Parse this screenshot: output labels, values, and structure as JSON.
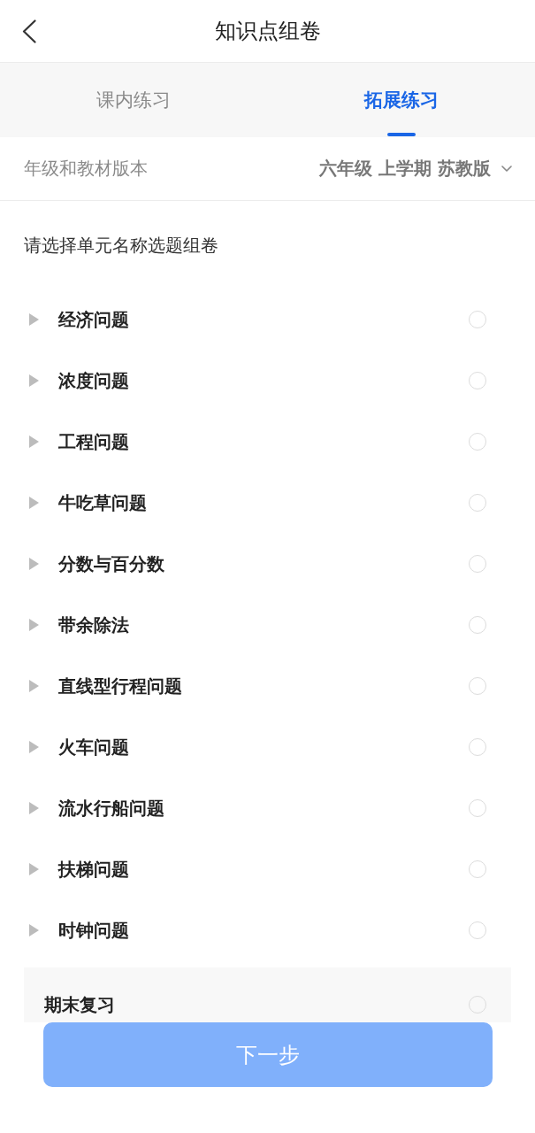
{
  "header": {
    "title": "知识点组卷"
  },
  "tabs": [
    {
      "label": "课内练习",
      "selected": false
    },
    {
      "label": "拓展练习",
      "selected": true
    }
  ],
  "grade_selector": {
    "label": "年级和教材版本",
    "value": "六年级 上学期 苏教版"
  },
  "instruction": "请选择单元名称选题组卷",
  "units": [
    {
      "name": "经济问题",
      "expanded": false,
      "selected": false
    },
    {
      "name": "浓度问题",
      "expanded": false,
      "selected": false
    },
    {
      "name": "工程问题",
      "expanded": false,
      "selected": false
    },
    {
      "name": "牛吃草问题",
      "expanded": false,
      "selected": false
    },
    {
      "name": "分数与百分数",
      "expanded": false,
      "selected": false
    },
    {
      "name": "带余除法",
      "expanded": false,
      "selected": false
    },
    {
      "name": "直线型行程问题",
      "expanded": false,
      "selected": false
    },
    {
      "name": "火车问题",
      "expanded": false,
      "selected": false
    },
    {
      "name": "流水行船问题",
      "expanded": false,
      "selected": false
    },
    {
      "name": "扶梯问题",
      "expanded": false,
      "selected": false
    },
    {
      "name": "时钟问题",
      "expanded": false,
      "selected": false
    }
  ],
  "final_review": {
    "name": "期末复习",
    "selected": false
  },
  "next_button": {
    "label": "下一步",
    "disabled": true
  }
}
